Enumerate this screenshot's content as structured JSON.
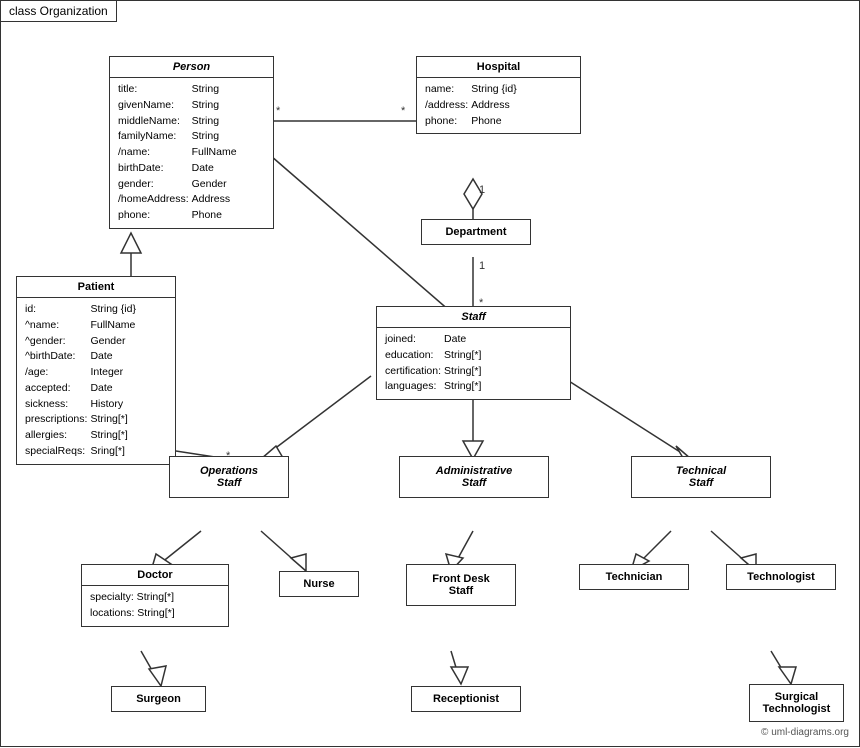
{
  "title": "class Organization",
  "classes": {
    "person": {
      "name": "Person",
      "italic": true,
      "attrs": [
        [
          "title:",
          "String"
        ],
        [
          "givenName:",
          "String"
        ],
        [
          "middleName:",
          "String"
        ],
        [
          "familyName:",
          "String"
        ],
        [
          "/name:",
          "FullName"
        ],
        [
          "birthDate:",
          "Date"
        ],
        [
          "gender:",
          "Gender"
        ],
        [
          "/homeAddress:",
          "Address"
        ],
        [
          "phone:",
          "Phone"
        ]
      ]
    },
    "hospital": {
      "name": "Hospital",
      "italic": false,
      "attrs": [
        [
          "name:",
          "String {id}"
        ],
        [
          "/address:",
          "Address"
        ],
        [
          "phone:",
          "Phone"
        ]
      ]
    },
    "department": {
      "name": "Department",
      "italic": false
    },
    "staff": {
      "name": "Staff",
      "italic": true,
      "attrs": [
        [
          "joined:",
          "Date"
        ],
        [
          "education:",
          "String[*]"
        ],
        [
          "certification:",
          "String[*]"
        ],
        [
          "languages:",
          "String[*]"
        ]
      ]
    },
    "patient": {
      "name": "Patient",
      "italic": false,
      "attrs": [
        [
          "id:",
          "String {id}"
        ],
        [
          "^name:",
          "FullName"
        ],
        [
          "^gender:",
          "Gender"
        ],
        [
          "^birthDate:",
          "Date"
        ],
        [
          "/age:",
          "Integer"
        ],
        [
          "accepted:",
          "Date"
        ],
        [
          "sickness:",
          "History"
        ],
        [
          "prescriptions:",
          "String[*]"
        ],
        [
          "allergies:",
          "String[*]"
        ],
        [
          "specialReqs:",
          "Sring[*]"
        ]
      ]
    },
    "operations_staff": {
      "name": "Operations Staff",
      "italic": true
    },
    "administrative_staff": {
      "name": "Administrative Staff",
      "italic": true
    },
    "technical_staff": {
      "name": "Technical Staff",
      "italic": true
    },
    "doctor": {
      "name": "Doctor",
      "italic": false,
      "attrs": [
        [
          "specialty: String[*]"
        ],
        [
          "locations: String[*]"
        ]
      ]
    },
    "nurse": {
      "name": "Nurse",
      "italic": false
    },
    "front_desk_staff": {
      "name": "Front Desk Staff",
      "italic": false
    },
    "technician": {
      "name": "Technician",
      "italic": false
    },
    "technologist": {
      "name": "Technologist",
      "italic": false
    },
    "surgeon": {
      "name": "Surgeon",
      "italic": false
    },
    "receptionist": {
      "name": "Receptionist",
      "italic": false
    },
    "surgical_technologist": {
      "name": "Surgical Technologist",
      "italic": false
    }
  },
  "watermark": "© uml-diagrams.org"
}
